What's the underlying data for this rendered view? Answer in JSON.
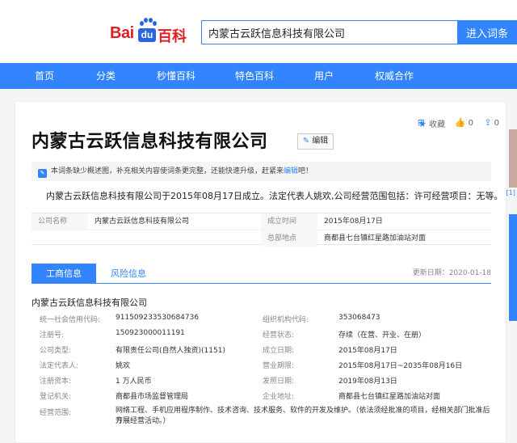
{
  "header": {
    "logo_left": "Bai",
    "logo_du": "du",
    "logo_right": "百科",
    "search_value": "内蒙古云跃信息科技有限公司",
    "search_button": "进入词条"
  },
  "nav": {
    "items": [
      "首页",
      "分类",
      "秒懂百科",
      "特色百科",
      "用户",
      "权威合作"
    ]
  },
  "toolbar": {
    "add_icon": "plus-square-icon",
    "collect_label": "收藏",
    "like_count": "0",
    "share_count": "0"
  },
  "entry": {
    "title": "内蒙古云跃信息科技有限公司",
    "edit_label": "编辑",
    "notice_text": "本词条缺少概述图，补充相关内容使词条更完整，还能快速升级，赶紧来",
    "notice_link": "编辑",
    "notice_tail": "吧！",
    "summary": "内蒙古云跃信息科技有限公司于2015年08月17日成立。法定代表人姚欢,公司经营范围包括：许可经营项目：无等。",
    "summary_ref": "[1]"
  },
  "basic_info": {
    "company_key": "公司名称",
    "company_val": "内蒙古云跃信息科技有限公司",
    "founded_key": "成立时间",
    "founded_val": "2015年08月17日",
    "hq_key": "总部地点",
    "hq_val": "商都县七台镇红星路加油站对面"
  },
  "tabs": {
    "active": "工商信息",
    "inactive": "风险信息",
    "update": "更新日期：2020-01-18"
  },
  "registration": {
    "company_name": "内蒙古云跃信息科技有限公司",
    "credit_code_key": "统一社会信用代码:",
    "credit_code_val": "91150923353068473​6",
    "org_code_key": "组织机构代码:",
    "org_code_val": "353068473",
    "reg_no_key": "注册号:",
    "reg_no_val": "150923000011191",
    "status_key": "经营状态:",
    "status_val": "存续（在营、开业、在册）",
    "type_key": "公司类型:",
    "type_val": "有限责任公司(自然人独资)(1151)",
    "est_key": "成立日期:",
    "est_val": "2015年08月17日",
    "rep_key": "法定代表人:",
    "rep_val": "姚欢",
    "term_key": "营业期限:",
    "term_val": "2015年08月17日~2035年08月16日",
    "capital_key": "注册资本:",
    "capital_val": "1 万人民币",
    "issue_key": "发照日期:",
    "issue_val": "2019年08月13日",
    "authority_key": "登记机关:",
    "authority_val": "商都县市场监督管理局",
    "address_key": "企业地址:",
    "address_val": "商都县七台镇红星路加油站对面",
    "scope_key": "经营范围:",
    "scope_line1": "网络工程、手机应用程序制作、技术咨询、技术服务、软件的开发及维护。（依法须经批准的项目，经相关部门批准后方",
    "scope_line2": "开展经营活动。）"
  }
}
